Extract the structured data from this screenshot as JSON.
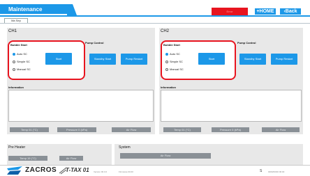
{
  "header": {
    "title": "Maintenance",
    "alarm_button": "Error",
    "home_button": "HOME",
    "back_button": "Back"
  },
  "tabs": [
    {
      "label": "Ma Sep"
    }
  ],
  "channels": [
    {
      "title": "CH1",
      "control_label": "Bubble Start",
      "pump_label": "Pump Control",
      "radio_options": [
        {
          "label": "Auto SC",
          "selected": true
        },
        {
          "label": "Simple SC",
          "selected": false
        },
        {
          "label": "Manual SC",
          "selected": false
        }
      ],
      "start_button": "Start",
      "pump_buttons": [
        "Standby Start",
        "Pump Restart"
      ],
      "info_label": "Information",
      "status_buttons": [
        "Temp 01 (°C)",
        "Pressure 0 (kPa)",
        "Air Flow"
      ]
    },
    {
      "title": "CH2",
      "control_label": "Bubble Start",
      "pump_label": "Pump Control",
      "radio_options": [
        {
          "label": "Auto SC",
          "selected": true
        },
        {
          "label": "Simple SC",
          "selected": false
        },
        {
          "label": "Manual SC",
          "selected": false
        }
      ],
      "start_button": "Start",
      "pump_buttons": [
        "Standby Start",
        "Pump Restart"
      ],
      "info_label": "Information",
      "status_buttons": [
        "Temp 01 (°C)",
        "Pressure 0 (kPa)",
        "Air Flow"
      ]
    }
  ],
  "preheater": {
    "label": "Pre Heater",
    "buttons": [
      "Temp 19 (°C)",
      "Air Flow"
    ]
  },
  "system": {
    "label": "System",
    "button": "Air Flow"
  },
  "footer": {
    "brand": "ZACROS",
    "model": "T-TAX 01",
    "version_text": "Version 00.0.0",
    "build_text": "Firmware 00.00",
    "counter": "S",
    "date_text": "0000/00/00 00:00"
  },
  "colors": {
    "accent": "#1c98e8",
    "alert": "#e8141f",
    "panel": "#e8e8e8"
  }
}
